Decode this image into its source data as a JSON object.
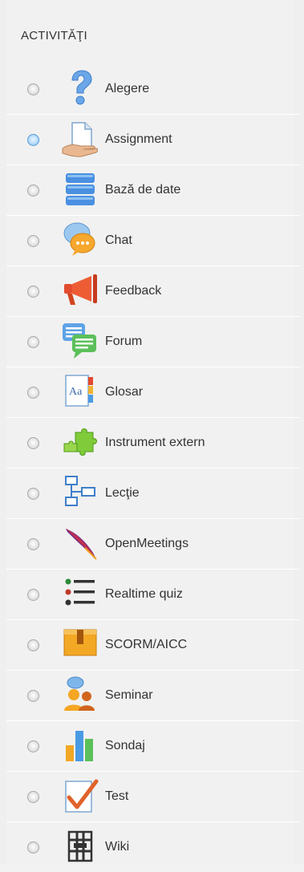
{
  "heading": "ACTIVITĂŢI",
  "activities": [
    {
      "label": "Alegere",
      "icon": "question-icon",
      "selected": false
    },
    {
      "label": "Assignment",
      "icon": "assignment-hand-icon",
      "selected": true
    },
    {
      "label": "Bază de date",
      "icon": "database-icon",
      "selected": false
    },
    {
      "label": "Chat",
      "icon": "chat-bubble-icon",
      "selected": false
    },
    {
      "label": "Feedback",
      "icon": "megaphone-icon",
      "selected": false
    },
    {
      "label": "Forum",
      "icon": "forum-bubbles-icon",
      "selected": false
    },
    {
      "label": "Glosar",
      "icon": "glossary-icon",
      "selected": false
    },
    {
      "label": "Instrument extern",
      "icon": "puzzle-icon",
      "selected": false
    },
    {
      "label": "Lecţie",
      "icon": "lesson-flowchart-icon",
      "selected": false
    },
    {
      "label": "OpenMeetings",
      "icon": "feather-icon",
      "selected": false
    },
    {
      "label": "Realtime quiz",
      "icon": "list-icon",
      "selected": false
    },
    {
      "label": "SCORM/AICC",
      "icon": "scorm-box-icon",
      "selected": false
    },
    {
      "label": "Seminar",
      "icon": "workshop-people-icon",
      "selected": false
    },
    {
      "label": "Sondaj",
      "icon": "survey-bars-icon",
      "selected": false
    },
    {
      "label": "Test",
      "icon": "quiz-check-icon",
      "selected": false
    },
    {
      "label": "Wiki",
      "icon": "wiki-icon",
      "selected": false
    }
  ]
}
